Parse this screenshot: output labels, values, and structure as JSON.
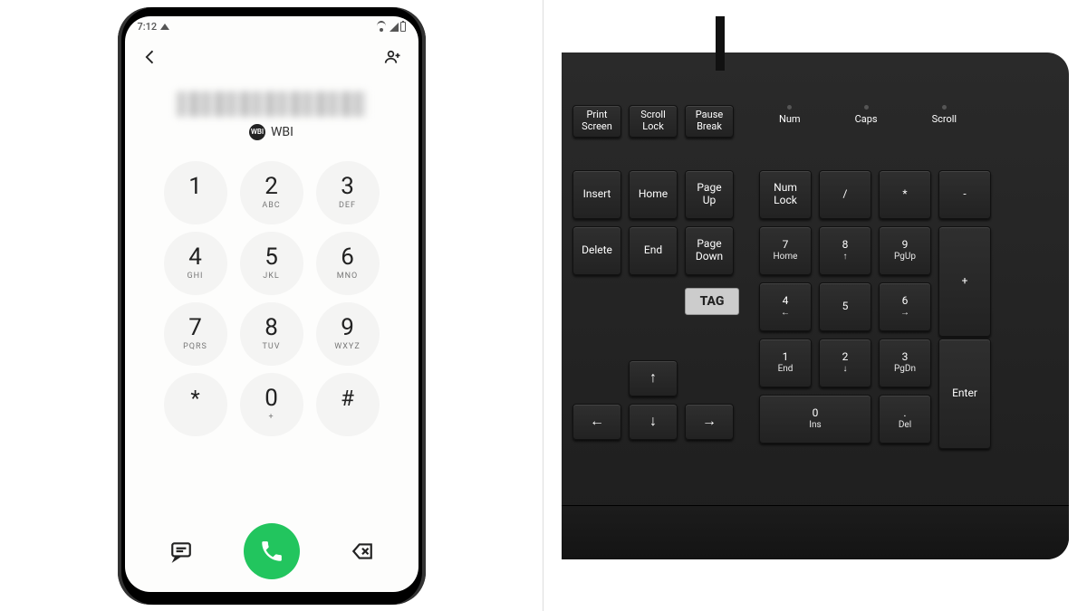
{
  "phone": {
    "status": {
      "time": "7:12"
    },
    "contact_label": "WBI",
    "contact_badge": "WBI",
    "keypad": [
      {
        "num": "1",
        "sub": ""
      },
      {
        "num": "2",
        "sub": "ABC"
      },
      {
        "num": "3",
        "sub": "DEF"
      },
      {
        "num": "4",
        "sub": "GHI"
      },
      {
        "num": "5",
        "sub": "JKL"
      },
      {
        "num": "6",
        "sub": "MNO"
      },
      {
        "num": "7",
        "sub": "PQRS"
      },
      {
        "num": "8",
        "sub": "TUV"
      },
      {
        "num": "9",
        "sub": "WXYZ"
      },
      {
        "num": "*",
        "sub": ""
      },
      {
        "num": "0",
        "sub": "+"
      },
      {
        "num": "#",
        "sub": ""
      }
    ]
  },
  "keyboard": {
    "brand": "TAG",
    "leds": [
      "Num",
      "Caps",
      "Scroll"
    ],
    "fn_keys": [
      {
        "l1": "Print",
        "l2": "Screen"
      },
      {
        "l1": "Scroll",
        "l2": "Lock"
      },
      {
        "l1": "Pause",
        "l2": "Break"
      }
    ],
    "nav_keys": [
      {
        "l1": "Insert",
        "l2": ""
      },
      {
        "l1": "Home",
        "l2": ""
      },
      {
        "l1": "Page",
        "l2": "Up"
      },
      {
        "l1": "Delete",
        "l2": ""
      },
      {
        "l1": "End",
        "l2": ""
      },
      {
        "l1": "Page",
        "l2": "Down"
      }
    ],
    "arrow_keys": {
      "up": "↑",
      "left": "←",
      "down": "↓",
      "right": "→"
    },
    "numpad": {
      "numlock": {
        "l1": "Num",
        "l2": "Lock"
      },
      "div": "/",
      "mul": "*",
      "sub": "-",
      "add": "+",
      "enter": "Enter",
      "k7": {
        "n": "7",
        "s": "Home"
      },
      "k8": {
        "n": "8",
        "s": "↑"
      },
      "k9": {
        "n": "9",
        "s": "PgUp"
      },
      "k4": {
        "n": "4",
        "s": "←"
      },
      "k5": {
        "n": "5",
        "s": ""
      },
      "k6": {
        "n": "6",
        "s": "→"
      },
      "k1": {
        "n": "1",
        "s": "End"
      },
      "k2": {
        "n": "2",
        "s": "↓"
      },
      "k3": {
        "n": "3",
        "s": "PgDn"
      },
      "k0": {
        "n": "0",
        "s": "Ins"
      },
      "kdot": {
        "n": ".",
        "s": "Del"
      }
    }
  }
}
